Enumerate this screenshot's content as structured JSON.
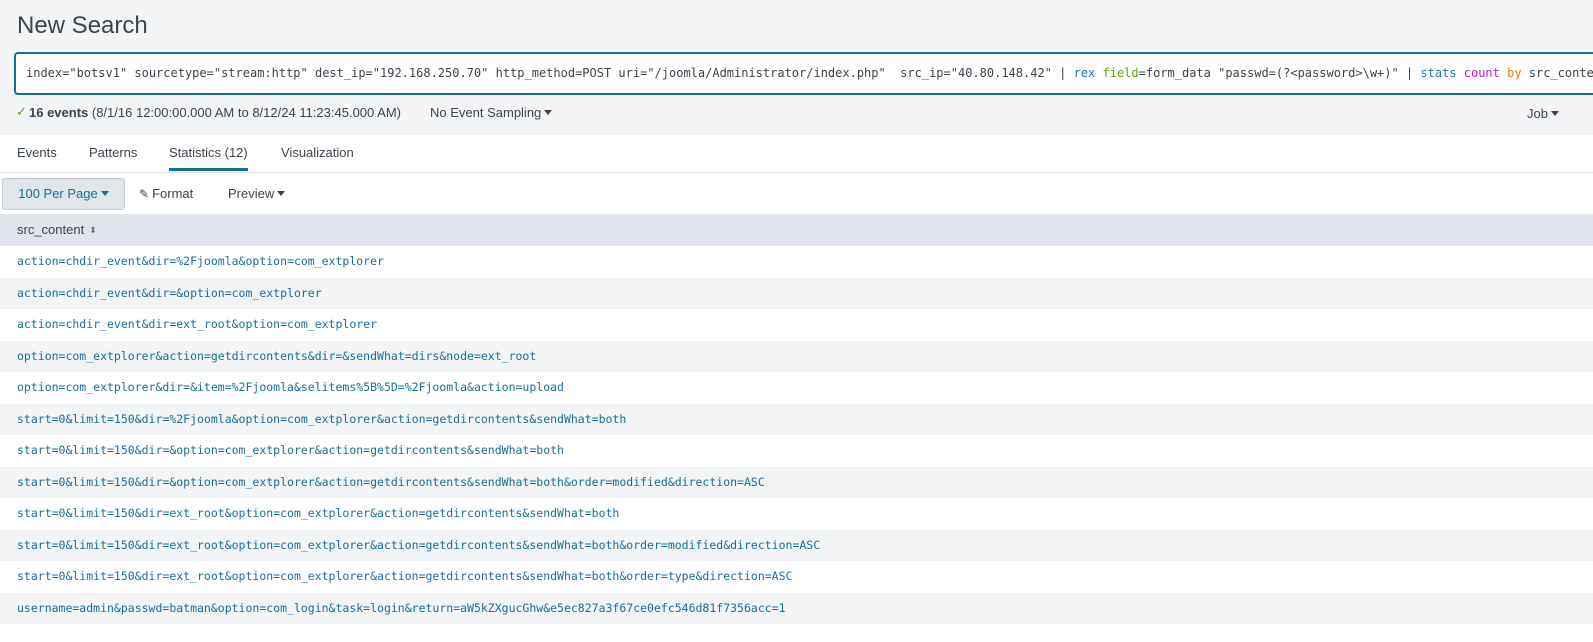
{
  "page": {
    "title": "New Search"
  },
  "search": {
    "query_parts": [
      {
        "text": "index=\"botsv1\" sourcetype=\"stream:http\" dest_ip=\"192.168.250.70\" http_method=POST uri=\"/joomla/Administrator/index.php\"  src_ip=\"40.80.148.42\" | ",
        "kind": "plain"
      },
      {
        "text": "rex",
        "kind": "cmd"
      },
      {
        "text": " ",
        "kind": "plain"
      },
      {
        "text": "field",
        "kind": "arg"
      },
      {
        "text": "=form_data \"passwd=(?<password>\\w+)\" | ",
        "kind": "plain"
      },
      {
        "text": "stats",
        "kind": "cmd"
      },
      {
        "text": " ",
        "kind": "plain"
      },
      {
        "text": "count",
        "kind": "fn"
      },
      {
        "text": " ",
        "kind": "plain"
      },
      {
        "text": "by",
        "kind": "by"
      },
      {
        "text": " src_content",
        "kind": "plain"
      }
    ]
  },
  "status": {
    "check_glyph": "✓",
    "event_count": "16 events",
    "time_range": " (8/1/16 12:00:00.000 AM to 8/12/24 11:23:45.000 AM)",
    "sampling": "No Event Sampling",
    "job": "Job"
  },
  "tabs": [
    {
      "label": "Events",
      "active": false
    },
    {
      "label": "Patterns",
      "active": false
    },
    {
      "label": "Statistics (12)",
      "active": true
    },
    {
      "label": "Visualization",
      "active": false
    }
  ],
  "toolbar": {
    "per_page": "100 Per Page",
    "format": "Format",
    "preview": "Preview"
  },
  "table": {
    "column": "src_content",
    "rows": [
      "action=chdir_event&dir=%2Fjoomla&option=com_extplorer",
      "action=chdir_event&dir=&option=com_extplorer",
      "action=chdir_event&dir=ext_root&option=com_extplorer",
      "option=com_extplorer&action=getdircontents&dir=&sendWhat=dirs&node=ext_root",
      "option=com_extplorer&dir=&item=%2Fjoomla&selitems%5B%5D=%2Fjoomla&action=upload",
      "start=0&limit=150&dir=%2Fjoomla&option=com_extplorer&action=getdircontents&sendWhat=both",
      "start=0&limit=150&dir=&option=com_extplorer&action=getdircontents&sendWhat=both",
      "start=0&limit=150&dir=&option=com_extplorer&action=getdircontents&sendWhat=both&order=modified&direction=ASC",
      "start=0&limit=150&dir=ext_root&option=com_extplorer&action=getdircontents&sendWhat=both",
      "start=0&limit=150&dir=ext_root&option=com_extplorer&action=getdircontents&sendWhat=both&order=modified&direction=ASC",
      "start=0&limit=150&dir=ext_root&option=com_extplorer&action=getdircontents&sendWhat=both&order=type&direction=ASC",
      "username=admin&passwd=batman&option=com_login&task=login&return=aW5kZXgucGhw&e5ec827a3f67ce0efc546d81f7356acc=1"
    ]
  }
}
